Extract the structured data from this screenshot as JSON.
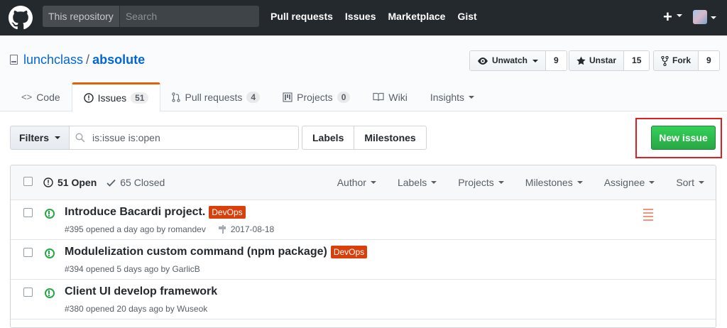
{
  "header": {
    "scope_label": "This repository",
    "search_placeholder": "Search",
    "nav": [
      "Pull requests",
      "Issues",
      "Marketplace",
      "Gist"
    ],
    "plus": "+"
  },
  "repo": {
    "owner": "lunchclass",
    "separator": "/",
    "name": "absolute",
    "watch": {
      "label": "Unwatch",
      "count": "9"
    },
    "star": {
      "label": "Unstar",
      "count": "15"
    },
    "fork": {
      "label": "Fork",
      "count": "9"
    }
  },
  "tabs": [
    {
      "label": "Code",
      "counter": ""
    },
    {
      "label": "Issues",
      "counter": "51"
    },
    {
      "label": "Pull requests",
      "counter": "4"
    },
    {
      "label": "Projects",
      "counter": "0"
    },
    {
      "label": "Wiki",
      "counter": ""
    },
    {
      "label": "Insights",
      "counter": ""
    }
  ],
  "subnav": {
    "filters_label": "Filters",
    "query": "is:issue is:open",
    "labels_label": "Labels",
    "milestones_label": "Milestones",
    "new_issue_label": "New issue"
  },
  "issues_header": {
    "open_label": "51 Open",
    "closed_label": "65 Closed",
    "menus": [
      "Author",
      "Labels",
      "Projects",
      "Milestones",
      "Assignee",
      "Sort"
    ]
  },
  "issues": [
    {
      "title": "Introduce Bacardi project.",
      "label": "DevOps",
      "meta": "#395 opened a day ago by romandev",
      "milestone": "2017-08-18"
    },
    {
      "title": "Modulelization custom command (npm package)",
      "label": "DevOps",
      "meta": "#394 opened 5 days ago by GarlicB",
      "milestone": ""
    },
    {
      "title": "Client UI develop framework",
      "label": "",
      "meta": "#380 opened 20 days ago by Wuseok",
      "milestone": ""
    }
  ],
  "colors": {
    "accent_orange": "#e36209",
    "label_devops": "#d93f0b",
    "new_issue_green": "#28a745",
    "highlight_red": "#e02020"
  }
}
